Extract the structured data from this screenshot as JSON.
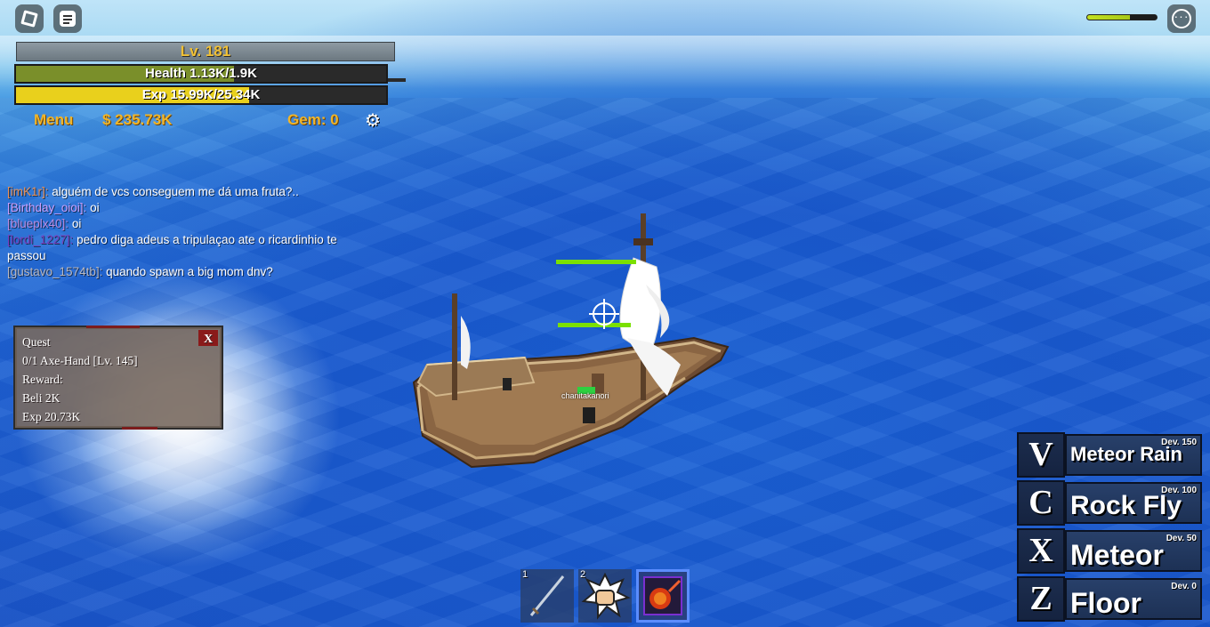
{
  "status": {
    "level": "Lv. 181",
    "health": {
      "text": "Health 1.13K/1.9K",
      "fraction": 0.59,
      "color": "#7a8f2a"
    },
    "exp": {
      "text": "Exp 15.99K/25.34K",
      "fraction": 0.63,
      "color": "#e9d01c"
    },
    "menu_label": "Menu",
    "money": "$ 235.73K",
    "gems": "Gem: 0"
  },
  "top_right": {
    "meter_fraction": 0.62
  },
  "chat": [
    {
      "name": "[imK1r]:",
      "name_color": "#e8925a",
      "message": "alguém de vcs conseguem me dá uma fruta?.."
    },
    {
      "name": "[Birthday_oioi]:",
      "name_color": "#c9a0ff",
      "message": "oi"
    },
    {
      "name": "[blueplx40]:",
      "name_color": "#b78be0",
      "message": "oi"
    },
    {
      "name": "[lordi_1227]:",
      "name_color": "#7a3fbf",
      "message": "pedro diga adeus a tripulaçao ate o ricardinhio te passou"
    },
    {
      "name": "[gustavo_1574tb]:",
      "name_color": "#b8b8c0",
      "message": "quando spawn a big mom dnv?"
    }
  ],
  "quest": {
    "title": "Quest",
    "close": "X",
    "objective": "0/1 Axe-Hand [Lv. 145]",
    "reward_label": "Reward:",
    "reward_beli": "Beli 2K",
    "reward_exp": "Exp 20.73K"
  },
  "world": {
    "player_name": "chanitakanori"
  },
  "skills": [
    {
      "key": "V",
      "name": "Meteor Rain",
      "requirement": "Dev. 150"
    },
    {
      "key": "C",
      "name": "Rock Fly",
      "requirement": "Dev. 100"
    },
    {
      "key": "X",
      "name": "Meteor",
      "requirement": "Dev. 50"
    },
    {
      "key": "Z",
      "name": "Floor",
      "requirement": "Dev. 0"
    }
  ],
  "hotbar": [
    {
      "number": "1",
      "icon": "sword-icon"
    },
    {
      "number": "2",
      "icon": "fist-icon"
    },
    {
      "number": "",
      "icon": "fruit-icon",
      "selected": true
    }
  ]
}
